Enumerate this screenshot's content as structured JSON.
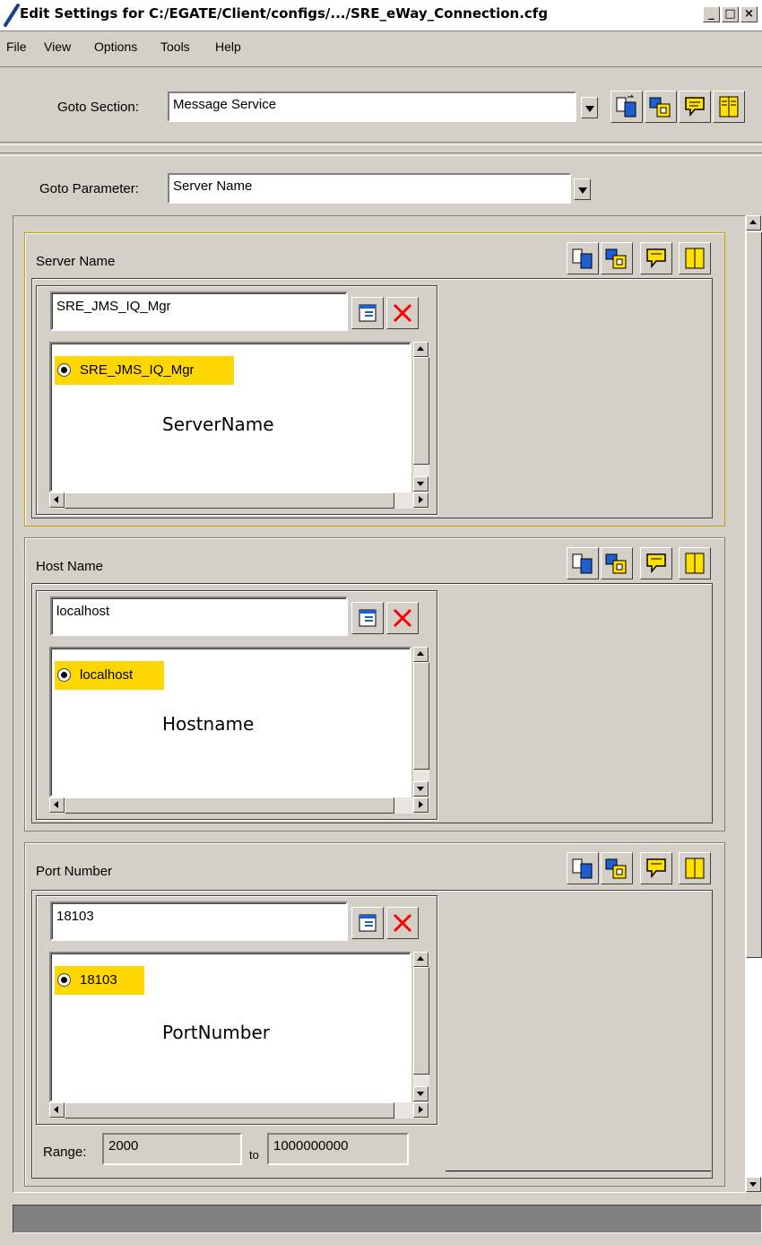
{
  "window": {
    "title": "Edit Settings for C:/EGATE/Client/configs/.../SRE_eWay_Connection.cfg",
    "controls": {
      "minimize": "_",
      "maximize": "□",
      "close": "×"
    }
  },
  "menu": [
    "File",
    "View",
    "Options",
    "Tools",
    "Help"
  ],
  "goto_section": {
    "label": "Goto Section:",
    "value": "Message Service"
  },
  "goto_parameter": {
    "label": "Goto Parameter:",
    "value": "Server Name"
  },
  "toolbar_icons": [
    "copy-default-icon",
    "paste-icon",
    "comment-icon",
    "help-book-icon"
  ],
  "parameters": [
    {
      "title": "Server Name",
      "value": "SRE_JMS_IQ_Mgr",
      "option": "SRE_JMS_IQ_Mgr",
      "caption": "ServerName"
    },
    {
      "title": "Host Name",
      "value": "localhost",
      "option": "localhost",
      "caption": "Hostname"
    },
    {
      "title": "Port Number",
      "value": "18103",
      "option": "18103",
      "caption": "PortNumber",
      "range": {
        "label": "Range:",
        "min": "2000",
        "to_label": "to",
        "max": "1000000000"
      }
    }
  ],
  "colors": {
    "selection": "#ffd700",
    "active_border": "#c8a000",
    "delete": "#ff0000"
  }
}
